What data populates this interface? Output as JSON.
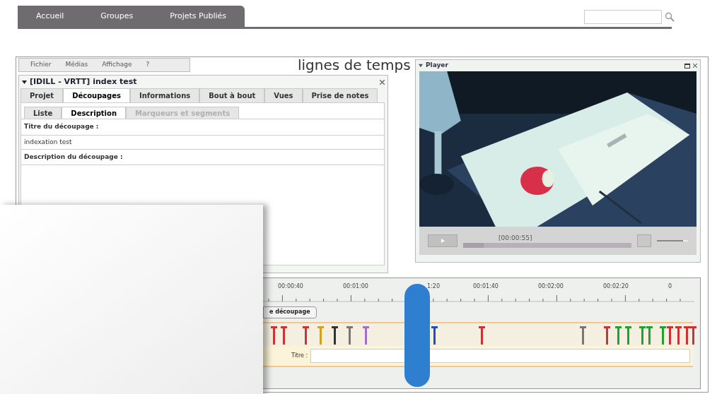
{
  "nav": {
    "tabs": [
      {
        "label": "Accueil",
        "selected": false
      },
      {
        "label": "Groupes",
        "selected": false
      },
      {
        "label": "Projets Publiés",
        "selected": false
      }
    ],
    "search": {
      "kind": "field"
    }
  },
  "menu": [
    "Fichier",
    "Médias",
    "Affichage",
    "?"
  ],
  "heading": "lignes de temps",
  "project": {
    "title": "[IDILL - VRTT] index test",
    "expanded": true,
    "tabs": [
      {
        "label": "Projet",
        "selected": false
      },
      {
        "label": "Découpages",
        "selected": true
      },
      {
        "label": "Informations",
        "selected": false
      },
      {
        "label": "Bout à bout",
        "selected": false
      },
      {
        "label": "Vues",
        "selected": false
      },
      {
        "label": "Prise de notes",
        "selected": false
      }
    ],
    "subtabs": [
      {
        "label": "Liste",
        "selected": false,
        "disabled": false
      },
      {
        "label": "Description",
        "selected": true,
        "disabled": false
      },
      {
        "label": "Marqueurs et segments",
        "selected": false,
        "disabled": true
      }
    ],
    "fields": [
      {
        "label": "Titre du découpage :",
        "value": "indexation test"
      },
      {
        "label": "Description du découpage :"
      }
    ]
  },
  "player": {
    "title": "Player",
    "expanded": true,
    "time": "[00:00:55]",
    "progress": {
      "level": 0.12
    },
    "volume": {
      "level": 0.85
    }
  },
  "timeline": {
    "ticks": [
      "00:00:40",
      "00:01:00",
      "1:20",
      "00:01:40",
      "00:02:00",
      "00:02:20",
      "0"
    ],
    "button": "e découpage",
    "title_label": "Titre :",
    "markers": [
      {
        "color": "#cc3333"
      },
      {
        "color": "#cc3333"
      },
      {
        "color": "#cc3333"
      },
      {
        "color": "#d4a020"
      },
      {
        "color": "#333333"
      },
      {
        "color": "#777777"
      },
      {
        "color": "#a070c8"
      },
      {
        "color": "#2050c0"
      },
      {
        "color": "#cc3333"
      },
      {
        "color": "#777777"
      },
      {
        "color": "#cc3333"
      },
      {
        "color": "#22a030"
      },
      {
        "color": "#22a030"
      },
      {
        "color": "#22a030"
      },
      {
        "color": "#22a030"
      },
      {
        "color": "#22a030"
      },
      {
        "color": "#cc3333"
      },
      {
        "color": "#cc3333"
      },
      {
        "color": "#cc3333"
      },
      {
        "color": "#cc3333"
      }
    ]
  }
}
